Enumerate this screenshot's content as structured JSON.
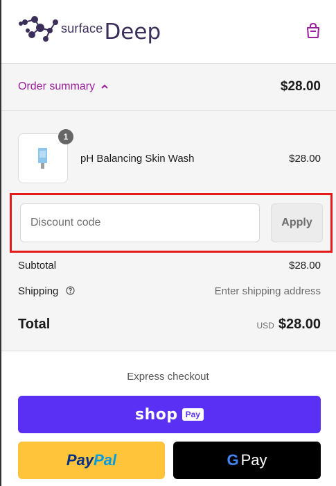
{
  "header": {
    "logo_small": "surface",
    "logo_big": "Deep",
    "cart_icon": "shopping-bag-icon"
  },
  "summary": {
    "toggle_label": "Order summary",
    "toggle_icon": "chevron-up-icon",
    "total": "$28.00"
  },
  "product": {
    "name": "pH Balancing Skin Wash",
    "price": "$28.00",
    "quantity": "1"
  },
  "discount": {
    "placeholder": "Discount code",
    "apply_label": "Apply"
  },
  "totals": {
    "subtotal_label": "Subtotal",
    "subtotal_value": "$28.00",
    "shipping_label": "Shipping",
    "shipping_value": "Enter shipping address",
    "total_label": "Total",
    "currency": "USD",
    "total_value": "$28.00"
  },
  "express": {
    "label": "Express checkout",
    "shop_word": "shop",
    "shop_pay_chip": "Pay",
    "paypal_part1": "Pay",
    "paypal_part2": "Pal",
    "gpay_g": "G",
    "gpay_pay": "Pay"
  },
  "colors": {
    "accent": "#9b1f9a",
    "shop_pay": "#5a31f4",
    "paypal": "#ffc439",
    "highlight": "#e51a1a"
  }
}
